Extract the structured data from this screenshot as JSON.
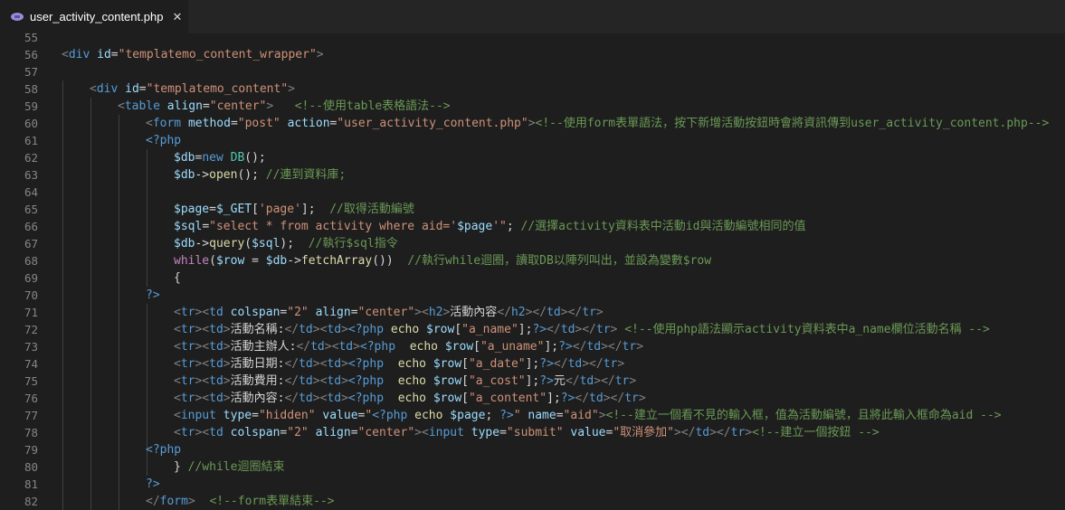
{
  "tab": {
    "filename": "user_activity_content.php",
    "close": "✕",
    "icon": "php-elephant-icon"
  },
  "colors": {
    "background": "#1e1e1e",
    "tabbar": "#252526",
    "comment": "#6a9955",
    "string": "#ce9178",
    "tag": "#569cd6"
  },
  "lines": [
    {
      "n": "55",
      "html": ""
    },
    {
      "n": "56",
      "html": "<span class=\"t\">&lt;</span><span class=\"tag\">div</span> <span class=\"attr\">id</span><span class=\"txt\">=</span><span class=\"str\">\"templatemo_content_wrapper\"</span><span class=\"t\">&gt;</span>",
      "indent": 0
    },
    {
      "n": "57",
      "html": ""
    },
    {
      "n": "58",
      "html": "<span class=\"t\">&lt;</span><span class=\"tag\">div</span> <span class=\"attr\">id</span><span class=\"txt\">=</span><span class=\"str\">\"templatemo_content\"</span><span class=\"t\">&gt;</span>",
      "indent": 1
    },
    {
      "n": "59",
      "html": "<span class=\"t\">&lt;</span><span class=\"tag\">table</span> <span class=\"attr\">align</span><span class=\"txt\">=</span><span class=\"str\">\"center\"</span><span class=\"t\">&gt;</span>   <span class=\"cm\">&lt;!--使用table表格語法--&gt;</span>",
      "indent": 2
    },
    {
      "n": "60",
      "html": "<span class=\"t\">&lt;</span><span class=\"tag\">form</span> <span class=\"attr\">method</span><span class=\"txt\">=</span><span class=\"str\">\"post\"</span> <span class=\"attr\">action</span><span class=\"txt\">=</span><span class=\"str\">\"user_activity_content.php\"</span><span class=\"t\">&gt;</span><span class=\"cm\">&lt;!--使用form表單語法，按下新增活動按鈕時會將資訊傳到user_activity_content.php--&gt;</span>",
      "indent": 3
    },
    {
      "n": "61",
      "html": "<span class=\"php\">&lt;?php</span>",
      "indent": 3
    },
    {
      "n": "62",
      "html": "<span class=\"var\">$db</span><span class=\"txt\">=</span><span class=\"php\">new</span> <span class=\"cls\">DB</span><span class=\"txt\">();</span>",
      "indent": 4
    },
    {
      "n": "63",
      "html": "<span class=\"var\">$db</span><span class=\"txt\">-&gt;</span><span class=\"fn\">open</span><span class=\"txt\">(); </span><span class=\"cm\">//連到資料庫;</span>",
      "indent": 4
    },
    {
      "n": "64",
      "html": ""
    },
    {
      "n": "65",
      "html": "<span class=\"var\">$page</span><span class=\"txt\">=</span><span class=\"var\">$_GET</span><span class=\"txt\">[</span><span class=\"sq\">'page'</span><span class=\"txt\">];  </span><span class=\"cm\">//取得活動編號</span>",
      "indent": 4
    },
    {
      "n": "66",
      "html": "<span class=\"var\">$sql</span><span class=\"txt\">=</span><span class=\"str\">\"select * from activity where aid='</span><span class=\"var\">$page</span><span class=\"str\">'\"</span><span class=\"txt\">; </span><span class=\"cm\">//選擇activity資料表中活動id與活動編號相同的值</span>",
      "indent": 4
    },
    {
      "n": "67",
      "html": "<span class=\"var\">$db</span><span class=\"txt\">-&gt;</span><span class=\"fn\">query</span><span class=\"txt\">(</span><span class=\"var\">$sql</span><span class=\"txt\">);  </span><span class=\"cm\">//執行$sql指令</span>",
      "indent": 4
    },
    {
      "n": "68",
      "html": "<span class=\"kw\">while</span><span class=\"txt\">(</span><span class=\"var\">$row</span><span class=\"txt\"> = </span><span class=\"var\">$db</span><span class=\"txt\">-&gt;</span><span class=\"fn\">fetchArray</span><span class=\"txt\">())  </span><span class=\"cm\">//執行while迴圈，讀取DB以陣列叫出，並設為變數$row</span>",
      "indent": 4
    },
    {
      "n": "69",
      "html": "<span class=\"txt\">{</span>",
      "indent": 4
    },
    {
      "n": "70",
      "html": "<span class=\"php\">?&gt;</span>",
      "indent": 3
    },
    {
      "n": "71",
      "html": "<span class=\"t\">&lt;</span><span class=\"tag\">tr</span><span class=\"t\">&gt;&lt;</span><span class=\"tag\">td</span> <span class=\"attr\">colspan</span><span class=\"txt\">=</span><span class=\"str\">\"2\"</span> <span class=\"attr\">align</span><span class=\"txt\">=</span><span class=\"str\">\"center\"</span><span class=\"t\">&gt;&lt;</span><span class=\"tag\">h2</span><span class=\"t\">&gt;</span><span class=\"txt\">活動內容</span><span class=\"t\">&lt;/</span><span class=\"tag\">h2</span><span class=\"t\">&gt;&lt;/</span><span class=\"tag\">td</span><span class=\"t\">&gt;&lt;/</span><span class=\"tag\">tr</span><span class=\"t\">&gt;</span>",
      "indent": 4
    },
    {
      "n": "72",
      "html": "<span class=\"t\">&lt;</span><span class=\"tag\">tr</span><span class=\"t\">&gt;&lt;</span><span class=\"tag\">td</span><span class=\"t\">&gt;</span><span class=\"txt\">活動名稱:</span><span class=\"t\">&lt;/</span><span class=\"tag\">td</span><span class=\"t\">&gt;&lt;</span><span class=\"tag\">td</span><span class=\"t\">&gt;</span><span class=\"php\">&lt;?php</span> <span class=\"fn\">echo</span> <span class=\"var\">$row</span><span class=\"txt\">[</span><span class=\"str\">\"a_name\"</span><span class=\"txt\">];</span><span class=\"php\">?&gt;</span><span class=\"t\">&lt;/</span><span class=\"tag\">td</span><span class=\"t\">&gt;&lt;/</span><span class=\"tag\">tr</span><span class=\"t\">&gt;</span> <span class=\"cm\">&lt;!--使用php語法顯示activity資料表中a_name欄位活動名稱 --&gt;</span>",
      "indent": 4
    },
    {
      "n": "73",
      "html": "<span class=\"t\">&lt;</span><span class=\"tag\">tr</span><span class=\"t\">&gt;&lt;</span><span class=\"tag\">td</span><span class=\"t\">&gt;</span><span class=\"txt\">活動主辦人:</span><span class=\"t\">&lt;/</span><span class=\"tag\">td</span><span class=\"t\">&gt;&lt;</span><span class=\"tag\">td</span><span class=\"t\">&gt;</span><span class=\"php\">&lt;?php</span>  <span class=\"fn\">echo</span> <span class=\"var\">$row</span><span class=\"txt\">[</span><span class=\"str\">\"a_uname\"</span><span class=\"txt\">];</span><span class=\"php\">?&gt;</span><span class=\"t\">&lt;/</span><span class=\"tag\">td</span><span class=\"t\">&gt;&lt;/</span><span class=\"tag\">tr</span><span class=\"t\">&gt;</span>",
      "indent": 4
    },
    {
      "n": "74",
      "html": "<span class=\"t\">&lt;</span><span class=\"tag\">tr</span><span class=\"t\">&gt;&lt;</span><span class=\"tag\">td</span><span class=\"t\">&gt;</span><span class=\"txt\">活動日期:</span><span class=\"t\">&lt;/</span><span class=\"tag\">td</span><span class=\"t\">&gt;&lt;</span><span class=\"tag\">td</span><span class=\"t\">&gt;</span><span class=\"php\">&lt;?php</span>  <span class=\"fn\">echo</span> <span class=\"var\">$row</span><span class=\"txt\">[</span><span class=\"str\">\"a_date\"</span><span class=\"txt\">];</span><span class=\"php\">?&gt;</span><span class=\"t\">&lt;/</span><span class=\"tag\">td</span><span class=\"t\">&gt;&lt;/</span><span class=\"tag\">tr</span><span class=\"t\">&gt;</span>",
      "indent": 4
    },
    {
      "n": "75",
      "html": "<span class=\"t\">&lt;</span><span class=\"tag\">tr</span><span class=\"t\">&gt;&lt;</span><span class=\"tag\">td</span><span class=\"t\">&gt;</span><span class=\"txt\">活動費用:</span><span class=\"t\">&lt;/</span><span class=\"tag\">td</span><span class=\"t\">&gt;&lt;</span><span class=\"tag\">td</span><span class=\"t\">&gt;</span><span class=\"php\">&lt;?php</span>  <span class=\"fn\">echo</span> <span class=\"var\">$row</span><span class=\"txt\">[</span><span class=\"str\">\"a_cost\"</span><span class=\"txt\">];</span><span class=\"php\">?&gt;</span><span class=\"txt\">元</span><span class=\"t\">&lt;/</span><span class=\"tag\">td</span><span class=\"t\">&gt;&lt;/</span><span class=\"tag\">tr</span><span class=\"t\">&gt;</span>",
      "indent": 4
    },
    {
      "n": "76",
      "html": "<span class=\"t\">&lt;</span><span class=\"tag\">tr</span><span class=\"t\">&gt;&lt;</span><span class=\"tag\">td</span><span class=\"t\">&gt;</span><span class=\"txt\">活動內容:</span><span class=\"t\">&lt;/</span><span class=\"tag\">td</span><span class=\"t\">&gt;&lt;</span><span class=\"tag\">td</span><span class=\"t\">&gt;</span><span class=\"php\">&lt;?php</span>  <span class=\"fn\">echo</span> <span class=\"var\">$row</span><span class=\"txt\">[</span><span class=\"str\">\"a_content\"</span><span class=\"txt\">];</span><span class=\"php\">?&gt;</span><span class=\"t\">&lt;/</span><span class=\"tag\">td</span><span class=\"t\">&gt;&lt;/</span><span class=\"tag\">tr</span><span class=\"t\">&gt;</span>",
      "indent": 4
    },
    {
      "n": "77",
      "html": "<span class=\"t\">&lt;</span><span class=\"tag\">input</span> <span class=\"attr\">type</span><span class=\"txt\">=</span><span class=\"str\">\"hidden\"</span> <span class=\"attr\">value</span><span class=\"txt\">=</span><span class=\"str\">\"</span><span class=\"php\">&lt;?php</span> <span class=\"fn\">echo</span> <span class=\"var\">$page</span><span class=\"txt\">; </span><span class=\"php\">?&gt;</span><span class=\"str\">\"</span> <span class=\"attr\">name</span><span class=\"txt\">=</span><span class=\"str\">\"aid\"</span><span class=\"t\">&gt;</span><span class=\"cm\">&lt;!--建立一個看不見的輸入框，值為活動編號，且將此輸入框命為aid --&gt;</span>",
      "indent": 4
    },
    {
      "n": "78",
      "html": "<span class=\"t\">&lt;</span><span class=\"tag\">tr</span><span class=\"t\">&gt;&lt;</span><span class=\"tag\">td</span> <span class=\"attr\">colspan</span><span class=\"txt\">=</span><span class=\"str\">\"2\"</span> <span class=\"attr\">align</span><span class=\"txt\">=</span><span class=\"str\">\"center\"</span><span class=\"t\">&gt;&lt;</span><span class=\"tag\">input</span> <span class=\"attr\">type</span><span class=\"txt\">=</span><span class=\"str\">\"submit\"</span> <span class=\"attr\">value</span><span class=\"txt\">=</span><span class=\"str\">\"取消參加\"</span><span class=\"t\">&gt;&lt;/</span><span class=\"tag\">td</span><span class=\"t\">&gt;&lt;/</span><span class=\"tag\">tr</span><span class=\"t\">&gt;</span><span class=\"cm\">&lt;!--建立一個按鈕 --&gt;</span>",
      "indent": 4
    },
    {
      "n": "79",
      "html": "<span class=\"php\">&lt;?php</span>",
      "indent": 3
    },
    {
      "n": "80",
      "html": "<span class=\"txt\">} </span><span class=\"cm\">//while迴圈結束</span>",
      "indent": 4
    },
    {
      "n": "81",
      "html": "<span class=\"php\">?&gt;</span>",
      "indent": 3
    },
    {
      "n": "82",
      "html": "<span class=\"t\">&lt;/</span><span class=\"tag\">form</span><span class=\"t\">&gt;</span>  <span class=\"cm\">&lt;!--form表單結束--&gt;</span>",
      "indent": 3
    }
  ]
}
